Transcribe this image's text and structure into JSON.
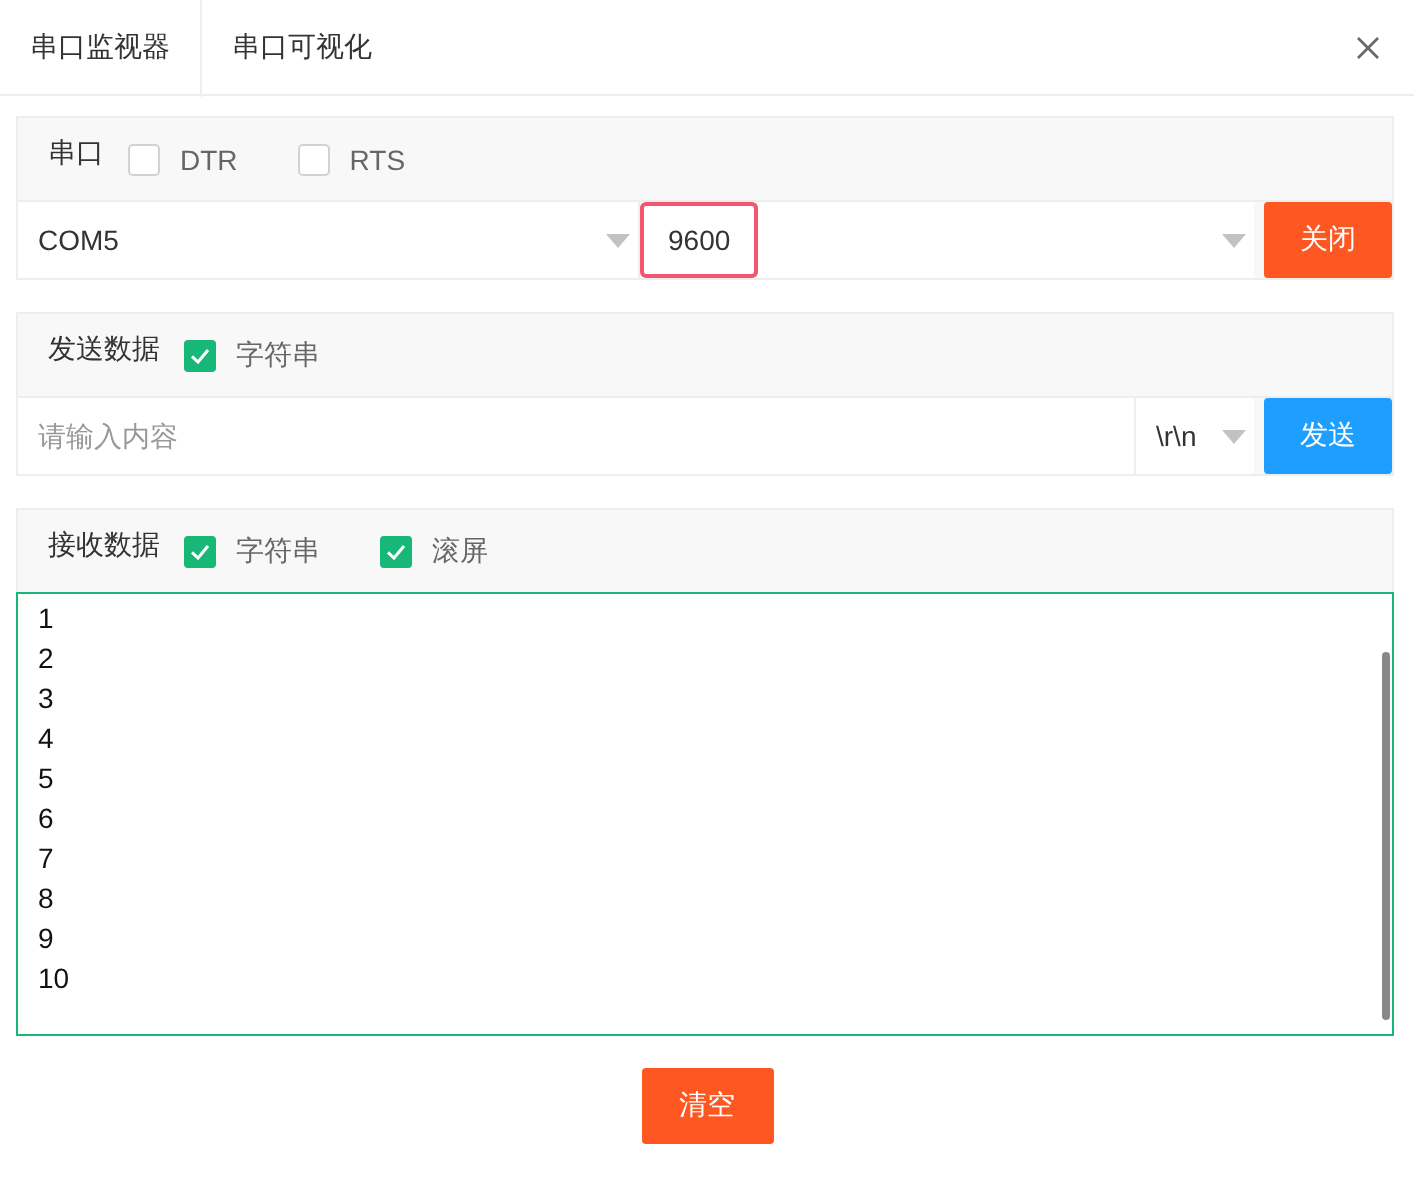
{
  "tabs": [
    {
      "label": "串口监视器",
      "selected": true
    },
    {
      "label": "串口可视化",
      "selected": false
    }
  ],
  "port_section": {
    "title": "串口",
    "options": [
      {
        "label": "DTR",
        "checked": false
      },
      {
        "label": "RTS",
        "checked": false
      }
    ],
    "port": "COM5",
    "baud": {
      "value": "9600",
      "highlighted": true
    },
    "button": "关闭"
  },
  "send_section": {
    "title": "发送数据",
    "options": [
      {
        "label": "字符串",
        "checked": true
      }
    ],
    "placeholder": "请输入内容",
    "line_ending": "\\r\\n",
    "button": "发送"
  },
  "receive_section": {
    "title": "接收数据",
    "options": [
      {
        "label": "字符串",
        "checked": true
      },
      {
        "label": "滚屏",
        "checked": true
      }
    ],
    "lines": [
      "1",
      "2",
      "3",
      "4",
      "5",
      "6",
      "7",
      "8",
      "9",
      "10"
    ]
  },
  "clear_button": "清空"
}
